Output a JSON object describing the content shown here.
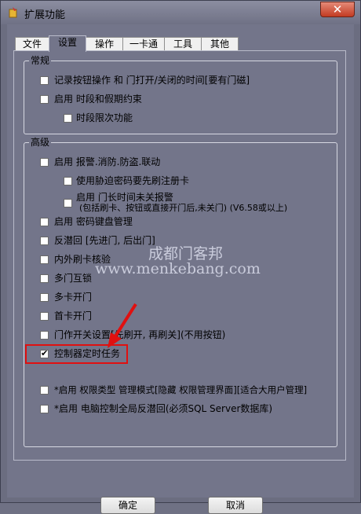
{
  "window": {
    "title": "扩展功能",
    "close_glyph": "✕"
  },
  "tabs": [
    {
      "label": "文件"
    },
    {
      "label": "设置"
    },
    {
      "label": "操作"
    },
    {
      "label": "一卡通"
    },
    {
      "label": "工具"
    },
    {
      "label": "其他"
    }
  ],
  "general": {
    "title": "常规",
    "items": [
      {
        "label": "记录按钮操作 和 门打开/关闭的时间[要有门磁]",
        "checked": false
      },
      {
        "label": "启用 时段和假期约束",
        "checked": false
      },
      {
        "label": "时段限次功能",
        "checked": false
      }
    ]
  },
  "advanced": {
    "title": "高级",
    "items": [
      {
        "label": "启用 报警.消防.防盗.联动",
        "checked": false
      },
      {
        "label": "使用胁迫密码要先刷注册卡",
        "checked": false
      },
      {
        "label": "启用 门长时间未关报警",
        "label2": "(包括刷卡、按钮或直接开门后,未关门) (V6.58或以上)",
        "checked": false
      },
      {
        "label": "启用 密码键盘管理",
        "checked": false
      },
      {
        "label": "反潜回 [先进门, 后出门]",
        "checked": false
      },
      {
        "label": "内外刷卡核验",
        "checked": false
      },
      {
        "label": "多门互锁",
        "checked": false
      },
      {
        "label": "多卡开门",
        "checked": false
      },
      {
        "label": "首卡开门",
        "checked": false
      },
      {
        "label": "门作开关设置[先刷开, 再刷关](不用按钮)",
        "checked": false
      },
      {
        "label": "控制器定时任务",
        "checked": true
      },
      {
        "label": "*启用 权限类型 管理模式[隐藏 权限管理界面][适合大用户管理]",
        "checked": false
      },
      {
        "label": "*启用 电脑控制全局反潜回(必须SQL Server数据库)",
        "checked": false
      }
    ]
  },
  "watermark": {
    "line1": "成都门客邦",
    "line2": "www.menkebang.com"
  },
  "buttons": {
    "ok": "确定",
    "cancel": "取消"
  },
  "colors": {
    "highlight": "#e01010",
    "arrow": "#e01010"
  }
}
